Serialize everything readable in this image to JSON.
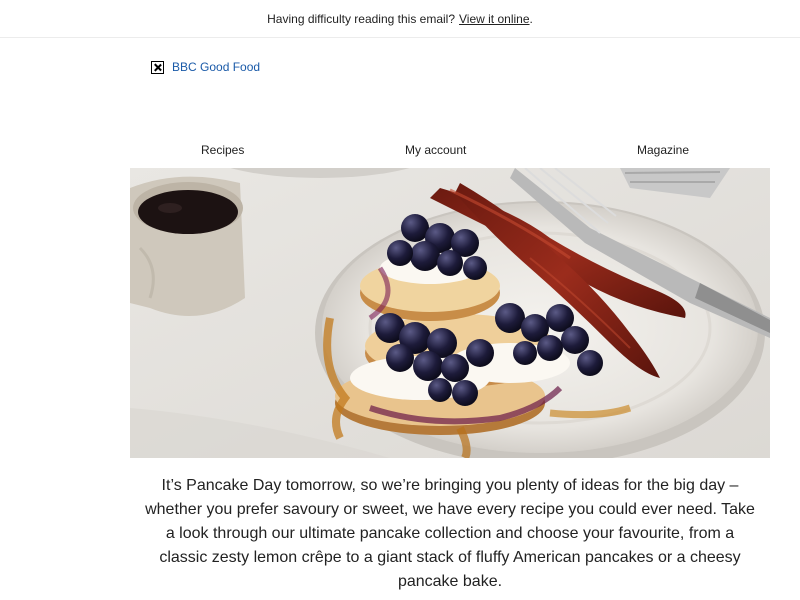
{
  "header": {
    "preheader_text": "Having difficulty reading this email?",
    "view_online_link": "View it online",
    "trailing_period": "."
  },
  "logo": {
    "alt_text": "BBC Good Food",
    "icon": "broken-image-icon"
  },
  "nav": {
    "items": [
      {
        "label": "Recipes"
      },
      {
        "label": "My account"
      },
      {
        "label": "Magazine"
      }
    ]
  },
  "hero": {
    "image": "pancakes-with-blueberries-and-bacon"
  },
  "body": {
    "paragraph": "It’s Pancake Day tomorrow, so we’re bringing you plenty of ideas for the big day – whether you prefer savoury or sweet, we have every recipe you could ever need. Take a look through our ultimate pancake collection and choose your favourite, from a classic zesty lemon crêpe to a giant stack of fluffy American pancakes or a cheesy pancake bake."
  },
  "colors": {
    "link_blue": "#1a5aa8",
    "text": "#222222",
    "divider": "#ececec"
  }
}
